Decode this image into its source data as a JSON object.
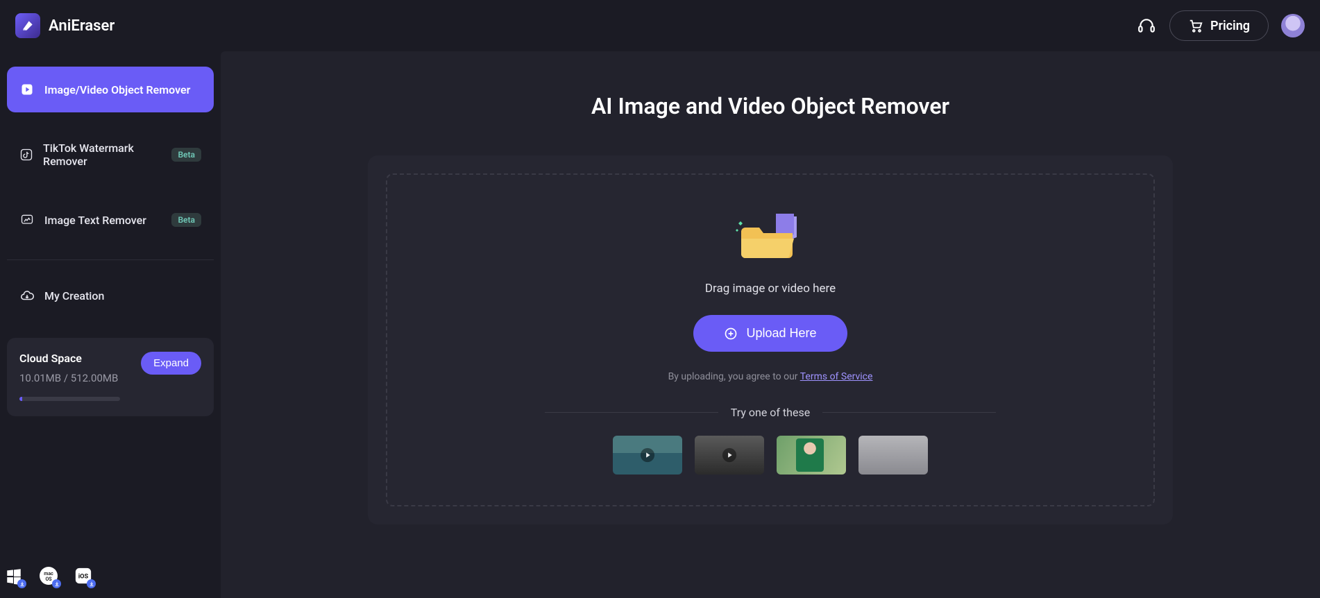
{
  "app": {
    "name": "AniEraser"
  },
  "header": {
    "pricing_label": "Pricing"
  },
  "sidebar": {
    "items": [
      {
        "label": "Image/Video Object Remover",
        "beta": false,
        "active": true
      },
      {
        "label": "TikTok Watermark Remover",
        "beta": true,
        "active": false
      },
      {
        "label": "Image Text Remover",
        "beta": true,
        "active": false
      }
    ],
    "beta_label": "Beta",
    "my_creation_label": "My Creation"
  },
  "cloud": {
    "title": "Cloud Space",
    "used": "10.01MB",
    "separator": " / ",
    "total": "512.00MB",
    "expand_label": "Expand",
    "percent": 2
  },
  "os_downloads": [
    "windows",
    "macos",
    "ios"
  ],
  "main": {
    "title": "AI Image and Video Object Remover",
    "drag_text": "Drag image or video here",
    "upload_label": "Upload Here",
    "tos_prefix": "By uploading, you agree to our ",
    "tos_link_text": "Terms of Service",
    "try_label": "Try one of these",
    "samples": [
      {
        "type": "video",
        "name": "sample-1"
      },
      {
        "type": "video",
        "name": "sample-2"
      },
      {
        "type": "image",
        "name": "sample-3"
      },
      {
        "type": "image",
        "name": "sample-4"
      }
    ]
  },
  "colors": {
    "accent": "#6a5cf6",
    "bg": "#1b1b24",
    "panel": "#262631"
  }
}
